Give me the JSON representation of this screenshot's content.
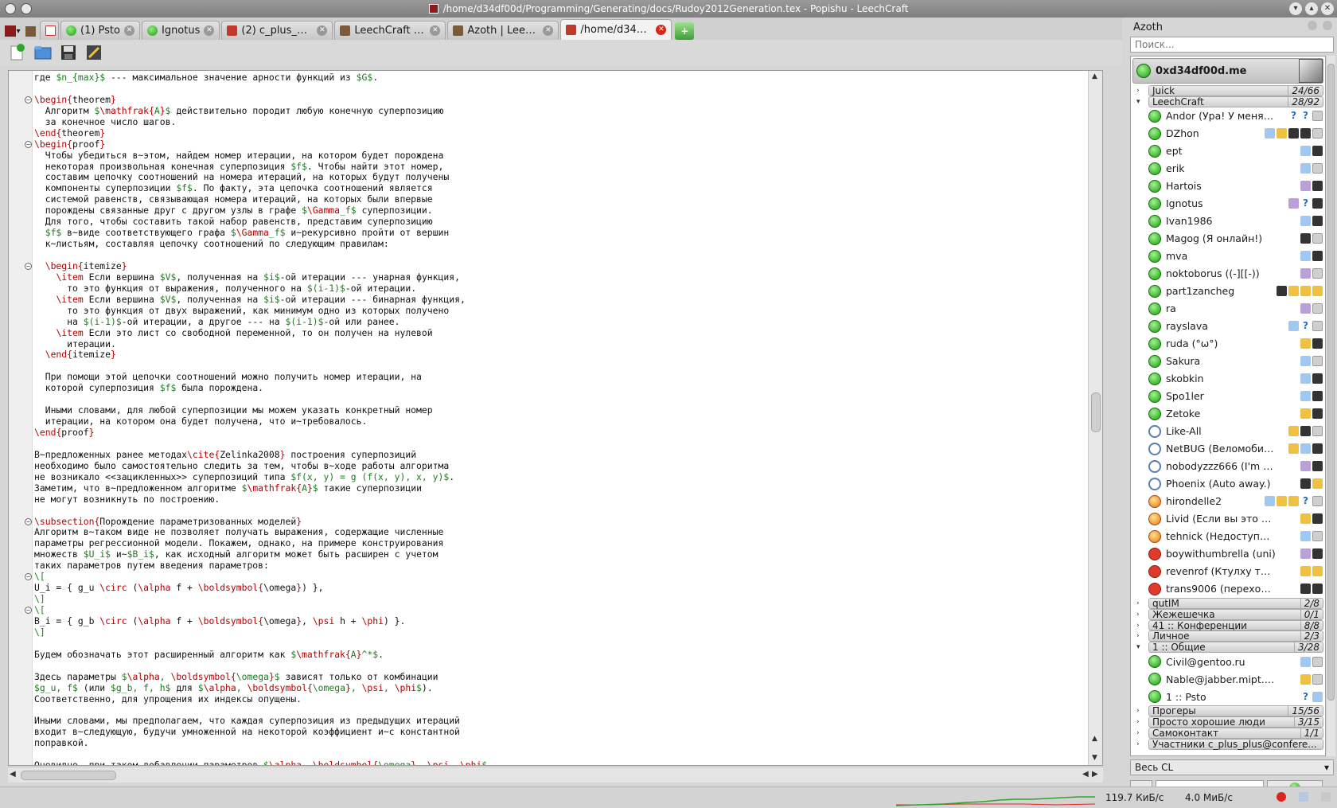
{
  "window": {
    "title": "/home/d34df00d/Programming/Generating/docs/Rudoy2012Generation.tex - Popishu - LeechCraft"
  },
  "tabs": [
    {
      "label": "",
      "icon": "gmail-icon",
      "kind": "mail"
    },
    {
      "label": "(1) Psto",
      "icon": "status-online-icon",
      "kind": "green"
    },
    {
      "label": "Ignotus",
      "icon": "status-online-icon",
      "kind": "green"
    },
    {
      "label": "(2) c_plus_plus...",
      "icon": "web-page-icon",
      "kind": "red"
    },
    {
      "label": "LeechCraft scr...",
      "icon": "web-page-icon",
      "kind": "brown"
    },
    {
      "label": "Azoth | Leech...",
      "icon": "web-page-icon",
      "kind": "brown"
    },
    {
      "label": "/home/d34df0...",
      "icon": "popishu-icon",
      "kind": "red",
      "active": true
    }
  ],
  "toolbar": {
    "new_label": "new-document-icon",
    "open_label": "open-document-icon",
    "save_label": "save-icon",
    "props_label": "properties-icon"
  },
  "editor": {
    "lines": [
      "где $n_{max}$ --- максимальное значение арности функций из $G$.",
      "",
      "\\begin{theorem}",
      "  Алгоритм $\\mathfrak{A}$ действительно породит любую конечную суперпозицию",
      "  за конечное число шагов.",
      "\\end{theorem}",
      "\\begin{proof}",
      "  Чтобы убедиться в~этом, найдем номер итерации, на котором будет порождена",
      "  некоторая произвольная конечная суперпозиция $f$. Чтобы найти этот номер,",
      "  составим цепочку соотношений на номера итераций, на которых будут получены",
      "  компоненты суперпозиции $f$. По факту, эта цепочка соотношений является",
      "  системой равенств, связывающая номера итераций, на которых были впервые",
      "  порождены связанные друг с другом узлы в графе $\\Gamma_f$ суперпозиции.",
      "  Для того, чтобы составить такой набор равенств, представим суперпозицию",
      "  $f$ в~виде соответствующего графа $\\Gamma_f$ и~рекурсивно пройти от вершин",
      "  к~листьям, составляя цепочку соотношений по следующим правилам:",
      "",
      "  \\begin{itemize}",
      "    \\item Если вершина $V$, полученная на $i$-ой итерации --- унарная функция,",
      "      то это функция от выражения, полученного на $(i-1)$-ой итерации.",
      "    \\item Если вершина $V$, полученная на $i$-ой итерации --- бинарная функция,",
      "      то это функция от двух выражений, как минимум одно из которых получено",
      "      на $(i-1)$-ой итерации, а другое --- на $(i-1)$-ой или ранее.",
      "    \\item Если это лист со свободной переменной, то он получен на нулевой",
      "      итерации.",
      "  \\end{itemize}",
      "",
      "  При помощи этой цепочки соотношений можно получить номер итерации, на",
      "  которой суперпозиция $f$ была порождена.",
      "",
      "  Иными словами, для любой суперпозиции мы можем указать конкретный номер",
      "  итерации, на котором она будет получена, что и~требовалось.",
      "\\end{proof}",
      "",
      "В~предложенных ранее методах\\cite{Zelinka2008} построения суперпозиций",
      "необходимо было самостоятельно следить за тем, чтобы в~ходе работы алгоритма",
      "не возникало <<зацикленных>> суперпозиций типа $f(x, y) = g (f(x, y), x, y)$.",
      "Заметим, что в~предложенном алгоритме $\\mathfrak{A}$ такие суперпозиции",
      "не могут возникнуть по построению.",
      "",
      "\\subsection{Порождение параметризованных моделей}",
      "Алгоритм в~таком виде не позволяет получать выражения, содержащие численные",
      "параметры регрессионной модели. Покажем, однако, на примере конструирования",
      "множеств $U_i$ и~$B_i$, как исходный алгоритм может быть расширен с учетом",
      "таких параметров путем введения параметров:",
      "\\[",
      "U_i = { g_u \\circ (\\alpha f + \\boldsymbol{\\omega}) },",
      "\\]",
      "\\[",
      "B_i = { g_b \\circ (\\alpha f + \\boldsymbol{\\omega}, \\psi h + \\phi) }.",
      "\\]",
      "",
      "Будем обозначать этот расширенный алгоритм как $\\mathfrak{A}^*$.",
      "",
      "Здесь параметры $\\alpha, \\boldsymbol{\\omega}$ зависят только от комбинации",
      "$g_u, f$ (или $g_b, f, h$ для $\\alpha, \\boldsymbol{\\omega}, \\psi, \\phi$).",
      "Соответственно, для упрощения их индексы опущены.",
      "",
      "Иными словами, мы предполагаем, что каждая суперпозиция из предыдущих итераций",
      "входит в~следующую, будучи умноженной на некоторой коэффициент и~с константной",
      "поправкой.",
      "",
      "Очевидно, при таком добавлении параметров $\\alpha, \\boldsymbol{\\omega}, \\psi, \\phi$"
    ],
    "folds": [
      2,
      6,
      17,
      40,
      45,
      48
    ]
  },
  "panel": {
    "title": "Azoth",
    "search_placeholder": "Поиск...",
    "account": "0xd34df00d.me",
    "roster": [
      {
        "type": "group",
        "name": "Juick",
        "count": "24/66",
        "expanded": false
      },
      {
        "type": "group",
        "name": "LeechCraft",
        "count": "28/92",
        "expanded": true
      },
      {
        "type": "contact",
        "name": "Andor (Ура! У меня н...",
        "status": "online",
        "icons": [
          "q",
          "q",
          "i-av"
        ]
      },
      {
        "type": "contact",
        "name": "DZhon",
        "status": "online",
        "icons": [
          "i-g",
          "i-o",
          "i-d",
          "i-d",
          "i-av"
        ]
      },
      {
        "type": "contact",
        "name": "ept",
        "status": "online",
        "icons": [
          "i-g",
          "i-d"
        ]
      },
      {
        "type": "contact",
        "name": "erik",
        "status": "online",
        "icons": [
          "i-g",
          "i-av"
        ]
      },
      {
        "type": "contact",
        "name": "Hartois",
        "status": "online",
        "icons": [
          "i-p",
          "i-d"
        ]
      },
      {
        "type": "contact",
        "name": "Ignotus",
        "status": "online",
        "icons": [
          "i-p",
          "q",
          "i-d"
        ]
      },
      {
        "type": "contact",
        "name": "Ivan1986",
        "status": "online",
        "icons": [
          "i-g",
          "i-d"
        ]
      },
      {
        "type": "contact",
        "name": "Magog (Я онлайн!)",
        "status": "online",
        "icons": [
          "i-d",
          "i-av"
        ]
      },
      {
        "type": "contact",
        "name": "mva",
        "status": "online",
        "icons": [
          "i-g",
          "i-d"
        ]
      },
      {
        "type": "contact",
        "name": "noktoborus ((-][[-))",
        "status": "online",
        "icons": [
          "i-p",
          "i-av"
        ]
      },
      {
        "type": "contact",
        "name": "part1zancheg",
        "status": "online",
        "icons": [
          "i-d",
          "i-o",
          "i-o",
          "i-o"
        ]
      },
      {
        "type": "contact",
        "name": "ra",
        "status": "online",
        "icons": [
          "i-p",
          "i-av"
        ]
      },
      {
        "type": "contact",
        "name": "rayslava",
        "status": "online",
        "icons": [
          "i-g",
          "q",
          "i-av"
        ]
      },
      {
        "type": "contact",
        "name": "ruda (°ω°)",
        "status": "online",
        "icons": [
          "i-o",
          "i-d"
        ]
      },
      {
        "type": "contact",
        "name": "Sakura",
        "status": "online",
        "icons": [
          "i-g",
          "i-av"
        ]
      },
      {
        "type": "contact",
        "name": "skobkin",
        "status": "online",
        "icons": [
          "i-g",
          "i-d"
        ]
      },
      {
        "type": "contact",
        "name": "Spo1ler",
        "status": "online",
        "icons": [
          "i-g",
          "i-d"
        ]
      },
      {
        "type": "contact",
        "name": "Zetoke",
        "status": "online",
        "icons": [
          "i-o",
          "i-d"
        ]
      },
      {
        "type": "contact",
        "name": "Like-All",
        "status": "away",
        "icons": [
          "i-o",
          "i-d",
          "i-av"
        ]
      },
      {
        "type": "contact",
        "name": "NetBUG (Веломобил...",
        "status": "away",
        "icons": [
          "i-o",
          "i-g",
          "i-d"
        ]
      },
      {
        "type": "contact",
        "name": "nobodyzzz666 (I'm not ...",
        "status": "away",
        "icons": [
          "i-p",
          "i-d"
        ]
      },
      {
        "type": "contact",
        "name": "Phoenix (Auto away.)",
        "status": "away",
        "icons": [
          "i-d",
          "i-o"
        ]
      },
      {
        "type": "contact",
        "name": "hirondelle2",
        "status": "chat",
        "icons": [
          "i-g",
          "i-o",
          "i-o",
          "q",
          "i-av"
        ]
      },
      {
        "type": "contact",
        "name": "Livid (Если вы это чита...",
        "status": "chat",
        "icons": [
          "i-o",
          "i-d"
        ]
      },
      {
        "type": "contact",
        "name": "tehnick (Недоступен.)",
        "status": "chat",
        "icons": [
          "i-g",
          "i-av"
        ]
      },
      {
        "type": "contact",
        "name": "boywithumbrella (uni)",
        "status": "dnd",
        "icons": [
          "i-p",
          "i-d"
        ]
      },
      {
        "type": "contact",
        "name": "revenrof (Ктулху тоже ...",
        "status": "dnd",
        "icons": [
          "i-o",
          "i-o"
        ]
      },
      {
        "type": "contact",
        "name": "trans9006 (переходим ...",
        "status": "dnd",
        "icons": [
          "i-d",
          "i-d"
        ]
      },
      {
        "type": "group",
        "name": "qutIM",
        "count": "2/8",
        "expanded": false
      },
      {
        "type": "group",
        "name": "Жежешечка",
        "count": "0/1",
        "expanded": false
      },
      {
        "type": "group",
        "name": "41 :: Конференции",
        "count": "8/8",
        "expanded": false
      },
      {
        "type": "group",
        "name": "Личное",
        "count": "2/3",
        "expanded": false
      },
      {
        "type": "group",
        "name": "1 :: Общие",
        "count": "3/28",
        "expanded": true
      },
      {
        "type": "contact",
        "name": "Civil@gentoo.ru",
        "status": "online",
        "icons": [
          "i-g",
          "i-av"
        ]
      },
      {
        "type": "contact",
        "name": "Nable@jabber.mipt.ru (Y...",
        "status": "online",
        "icons": [
          "i-o",
          "i-av"
        ]
      },
      {
        "type": "contact",
        "name": "1 :: Psto",
        "status": "online",
        "icons": [
          "q",
          "i-g"
        ]
      },
      {
        "type": "group",
        "name": "Прогеры",
        "count": "15/56",
        "expanded": false
      },
      {
        "type": "group",
        "name": "Просто хорошие люди",
        "count": "3/15",
        "expanded": false
      },
      {
        "type": "group",
        "name": "Самоконтакт",
        "count": "1/1",
        "expanded": false
      },
      {
        "type": "group",
        "name": "Участники c_plus_plus@confere...",
        "count": "",
        "expanded": false
      }
    ],
    "cl_filter": "Весь CL"
  },
  "statusbar": {
    "download": "119.7 КиБ/с",
    "upload": "4.0 МиБ/с"
  },
  "colors": {
    "keyword": "#b30000",
    "math": "#1f7a1f",
    "online": "#1a9a12",
    "dnd": "#e03a2a"
  }
}
